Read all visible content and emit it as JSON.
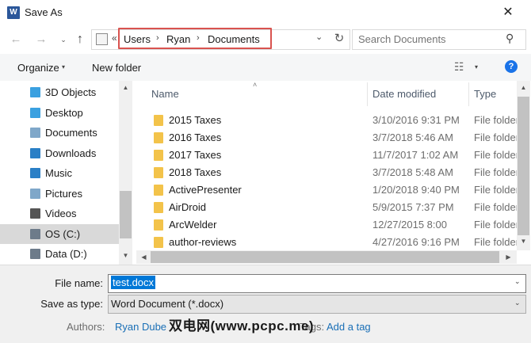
{
  "window": {
    "title": "Save As",
    "app_icon": "W",
    "close_glyph": "✕"
  },
  "nav": {
    "back_glyph": "←",
    "forward_glyph": "→",
    "recent_glyph": "⌄",
    "up_glyph": "↑",
    "overflow_glyph": "«",
    "breadcrumbs": [
      "Users",
      "Ryan",
      "Documents"
    ],
    "separator_glyph": "›",
    "dropdown_glyph": "⌄",
    "refresh_glyph": "↻",
    "search_placeholder": "Search Documents",
    "search_glyph": "⚲"
  },
  "toolbar": {
    "organize_label": "Organize",
    "caret_glyph": "▾",
    "new_folder_label": "New folder",
    "view_glyph": "☷",
    "help_glyph": "?"
  },
  "navpane": {
    "items": [
      {
        "label": "3D Objects",
        "icon": "3d-objects-icon",
        "color": "#3aa0e0"
      },
      {
        "label": "Desktop",
        "icon": "desktop-icon",
        "color": "#3aa0e0"
      },
      {
        "label": "Documents",
        "icon": "documents-icon",
        "color": "#7fa7c9"
      },
      {
        "label": "Downloads",
        "icon": "downloads-icon",
        "color": "#2a7fc6"
      },
      {
        "label": "Music",
        "icon": "music-icon",
        "color": "#2a7fc6"
      },
      {
        "label": "Pictures",
        "icon": "pictures-icon",
        "color": "#7fa7c9"
      },
      {
        "label": "Videos",
        "icon": "videos-icon",
        "color": "#555555"
      },
      {
        "label": "OS (C:)",
        "icon": "drive-icon",
        "color": "#6d7b8a"
      },
      {
        "label": "Data (D:)",
        "icon": "drive-icon",
        "color": "#6d7b8a"
      }
    ],
    "selected_index": 7
  },
  "filelist": {
    "sort_glyph": "˄",
    "columns": {
      "name": "Name",
      "date": "Date modified",
      "type": "Type"
    },
    "rows": [
      {
        "name": "2015 Taxes",
        "date": "3/10/2016 9:31 PM",
        "type": "File folder"
      },
      {
        "name": "2016 Taxes",
        "date": "3/7/2018 5:46 AM",
        "type": "File folder"
      },
      {
        "name": "2017 Taxes",
        "date": "11/7/2017 1:02 AM",
        "type": "File folder"
      },
      {
        "name": "2018 Taxes",
        "date": "3/7/2018 5:48 AM",
        "type": "File folder"
      },
      {
        "name": "ActivePresenter",
        "date": "1/20/2018 9:40 PM",
        "type": "File folder"
      },
      {
        "name": "AirDroid",
        "date": "5/9/2015 7:37 PM",
        "type": "File folder"
      },
      {
        "name": "ArcWelder",
        "date": "12/27/2015 8:00",
        "type": "File folder"
      },
      {
        "name": "author-reviews",
        "date": "4/27/2016 9:16 PM",
        "type": "File folder"
      }
    ],
    "scroll_up_glyph": "▲",
    "scroll_down_glyph": "▼",
    "scroll_left_glyph": "◀",
    "scroll_right_glyph": "▶"
  },
  "form": {
    "filename_label": "File name:",
    "filename_value": "test.docx",
    "savetype_label": "Save as type:",
    "savetype_value": "Word Document (*.docx)",
    "authors_label": "Authors:",
    "authors_value": "Ryan Dube",
    "tags_label": "Tags:",
    "tags_value": "Add a tag",
    "dropdown_glyph": "⌄"
  },
  "watermark": "双电网(www.pcpc.me)",
  "colors": {
    "highlight_box": "#d9534f",
    "selection": "#0078d7",
    "link": "#1a6fb6",
    "folder": "#f3c34a"
  }
}
